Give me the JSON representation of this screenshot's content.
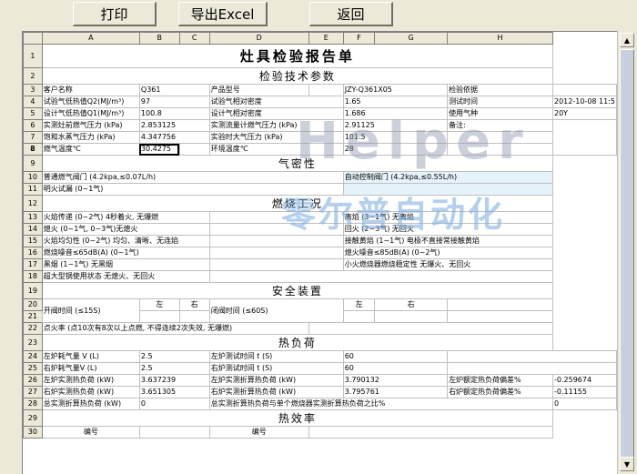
{
  "toolbar": {
    "print": "打印",
    "export": "导出Excel",
    "back": "返回"
  },
  "columns": [
    "A",
    "B",
    "C",
    "D",
    "E",
    "F",
    "G",
    "H"
  ],
  "title": "灶具检验报告单",
  "sections": {
    "tech": "检验技术参数",
    "airtight": "气密性",
    "combustion": "燃烧工况",
    "safety": "安全装置",
    "heat_load": "热负荷",
    "efficiency": "热效率"
  },
  "r3": {
    "a": "客户名称",
    "b": "Q361",
    "d": "产品型号",
    "e": "JZY-Q361X05",
    "g": "检验依据"
  },
  "r4": {
    "a": "试验气低热值Q2(MJ/m³)",
    "b": "97",
    "d": "试验气相对密度",
    "e": "1.65",
    "g": "测试时间",
    "h": "2012-10-08 11:5"
  },
  "r5": {
    "a": "设计气低热值Q1(MJ/m³)",
    "b": "100.8",
    "d": "设计气相对密度",
    "e": "1.686",
    "g": "使用气种",
    "h": "20Y"
  },
  "r6": {
    "a": "实测灶前燃气压力 (kPa)",
    "b": "2.853125",
    "d": "实测流量计燃气压力 (kPa)",
    "e": "2.91125",
    "g": "备注:"
  },
  "r7": {
    "a": "饱和水蒸气压力 (kPa)",
    "b": "4.347756",
    "d": "实验时大气压力 (kPa)",
    "e": "101.5"
  },
  "r8": {
    "a": "燃气温度℃",
    "b": "30.4275",
    "d": "环境温度℃",
    "e": "28"
  },
  "r10": {
    "a": "普通燃气阀门 (4.2kpa,≤0.07L/h)",
    "e": "自动控制阀门 (4.2kpa,≤0.55L/h)"
  },
  "r11": {
    "a": "明火试漏 (0~1气)"
  },
  "r13": {
    "a": "火焰传递 (0~2气)  4秒着火, 无爆燃",
    "e": "离焰 (3~1气)    无离焰"
  },
  "r14": {
    "a": "熄火 (0~1气, 0~3气)无熄火",
    "e": "回火 (2~3气)    无回火"
  },
  "r15": {
    "a": "  火焰均匀性 (0~2气)  均匀、清晰、无连焰",
    "e": "接触黄焰 (1~1气)  电极不直接常接触黄焰"
  },
  "r16": {
    "a": "燃烧噪音≤65dB(A) (0~1气)",
    "e": "熄火噪音≤85dB(A) (0~2气)"
  },
  "r17": {
    "a": "黑烟 (1~1气)   无黑烟",
    "e": "小火燃烧器燃烧稳定性  无爆火、无回火"
  },
  "r18": {
    "a": "超大型锅使用状态 无熄火、无回火"
  },
  "r20": {
    "a": "开阀时间 (≤15S)",
    "b": "左",
    "c": "右",
    "d": "闭阀时间 (≤60S)",
    "e": "左",
    "f": "右"
  },
  "r22": {
    "a": "点火率 (点10次有8次以上点燃, 不得连续2次失效, 无爆燃)"
  },
  "r24": {
    "a": "左炉耗气量 V (L)",
    "b": "2.5",
    "d": "左炉测试时间  t  (S)",
    "e": "60"
  },
  "r25": {
    "a": "右炉耗气量V (L)",
    "b": "2.5",
    "d": "右炉测试时间  t  (S)",
    "e": "60"
  },
  "r26": {
    "a": "左炉实测热负荷 (kW)",
    "b": "3.637239",
    "d": "左炉实测折算热负荷 (kW)",
    "e": "3.790132",
    "g": "左炉额定热负荷偏差%",
    "h": "-0.259674"
  },
  "r27": {
    "a": "右炉实测热负荷 (kW)",
    "b": "3.651305",
    "d": "右炉实测折算热负荷 (kW)",
    "e": "3.795761",
    "g": "右炉额定热负荷偏差%",
    "h": "-0.11155"
  },
  "r28": {
    "a": "总实测折算热负荷 (kW)",
    "b": "0",
    "d": "总实测折算热负荷与单个燃烧器实测折算热负荷之比%",
    "h": "0"
  },
  "r30": {
    "a": "编号",
    "d": "编号"
  },
  "watermark": {
    "en": "Helper",
    "cn": "零尔普自动化"
  },
  "colors": {
    "background": "#ece9d8",
    "sheet": "#ffffff",
    "selection": "#000000"
  }
}
